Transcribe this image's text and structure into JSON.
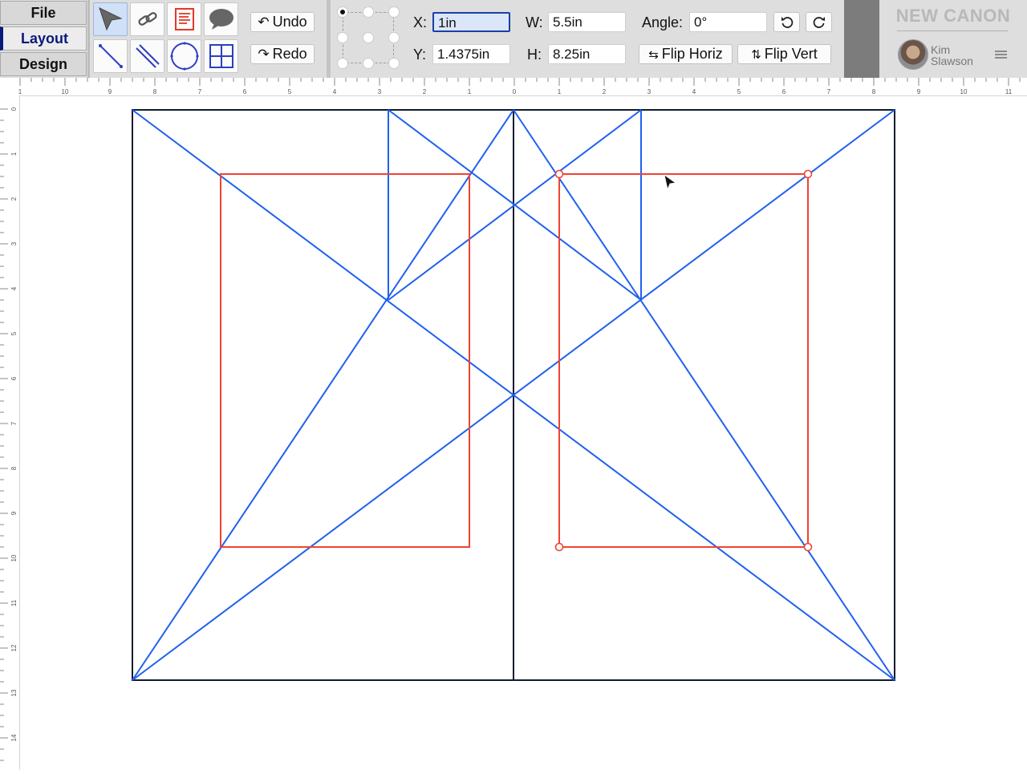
{
  "nav": {
    "tabs": [
      {
        "label": "File",
        "active": false
      },
      {
        "label": "Layout",
        "active": true
      },
      {
        "label": "Design",
        "active": false
      }
    ]
  },
  "tools": {
    "items": [
      {
        "name": "select-tool",
        "icon": "arrow-pointer-icon",
        "active": true
      },
      {
        "name": "link-tool",
        "icon": "chain-link-icon",
        "active": false
      },
      {
        "name": "text-tool",
        "icon": "text-block-icon",
        "active": false
      },
      {
        "name": "comment-tool",
        "icon": "speech-bubble-icon",
        "active": false
      },
      {
        "name": "line-tool",
        "icon": "line-icon",
        "active": false
      },
      {
        "name": "parallel-line-tool",
        "icon": "double-line-icon",
        "active": false
      },
      {
        "name": "circle-tool",
        "icon": "circle-icon",
        "active": false
      },
      {
        "name": "grid-tool",
        "icon": "grid-icon",
        "active": false
      }
    ],
    "undo_label": "Undo",
    "redo_label": "Redo"
  },
  "props": {
    "x_label": "X:",
    "x_value": "1in",
    "y_label": "Y:",
    "y_value": "1.4375in",
    "w_label": "W:",
    "w_value": "5.5in",
    "h_label": "H:",
    "h_value": "8.25in",
    "angle_label": "Angle:",
    "angle_value": "0°",
    "flip_horiz_label": "Flip Horiz",
    "flip_vert_label": "Flip Vert",
    "anchor_selected": "top-left"
  },
  "app": {
    "title": "NEW CANON",
    "user_first": "Kim",
    "user_last": "Slawson"
  },
  "rulers": {
    "top_labels": [
      "1",
      "10",
      "9",
      "8",
      "7",
      "6",
      "5",
      "4",
      "3",
      "2",
      "1",
      "0",
      "1",
      "2",
      "3",
      "4",
      "5",
      "6",
      "7",
      "8",
      "9",
      "10",
      "11"
    ],
    "left_labels": [
      "0",
      "1",
      "2",
      "3",
      "4",
      "5",
      "6",
      "7",
      "8",
      "9",
      "10",
      "11",
      "12",
      "13",
      "14"
    ]
  },
  "colors": {
    "construction_lines": "#2060ee",
    "text_blocks": "#ee4433",
    "page_border": "#0f1c2e",
    "accent": "#0a1a7a"
  }
}
